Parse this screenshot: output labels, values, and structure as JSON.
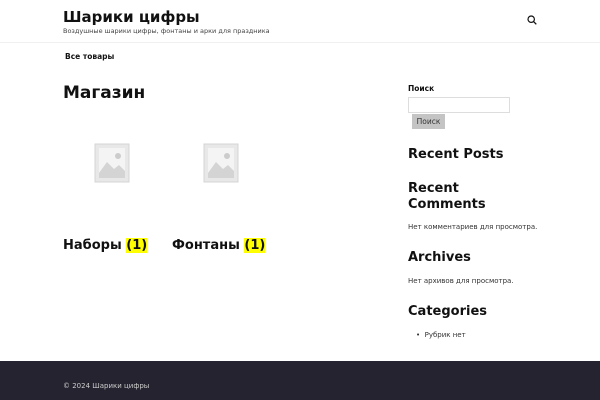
{
  "site": {
    "title": "Шарики цифры",
    "tagline": "Воздушные шарики цифры, фонтаны и арки для праздника"
  },
  "nav": {
    "items": [
      {
        "label": "Все товары"
      }
    ]
  },
  "main": {
    "title": "Магазин",
    "categories": [
      {
        "name": "Наборы",
        "count": "(1)"
      },
      {
        "name": "Фонтаны",
        "count": "(1)"
      }
    ]
  },
  "sidebar": {
    "search": {
      "label": "Поиск",
      "placeholder": "",
      "button": "Поиск"
    },
    "recent_posts": {
      "title": "Recent Posts"
    },
    "recent_comments": {
      "title": "Recent Comments",
      "text": "Нет комментариев для просмотра."
    },
    "archives": {
      "title": "Archives",
      "text": "Нет архивов для просмотра."
    },
    "categories": {
      "title": "Categories",
      "items": [
        "Рубрик нет"
      ]
    }
  },
  "footer": {
    "copyright": "© 2024 Шарики цифры"
  }
}
